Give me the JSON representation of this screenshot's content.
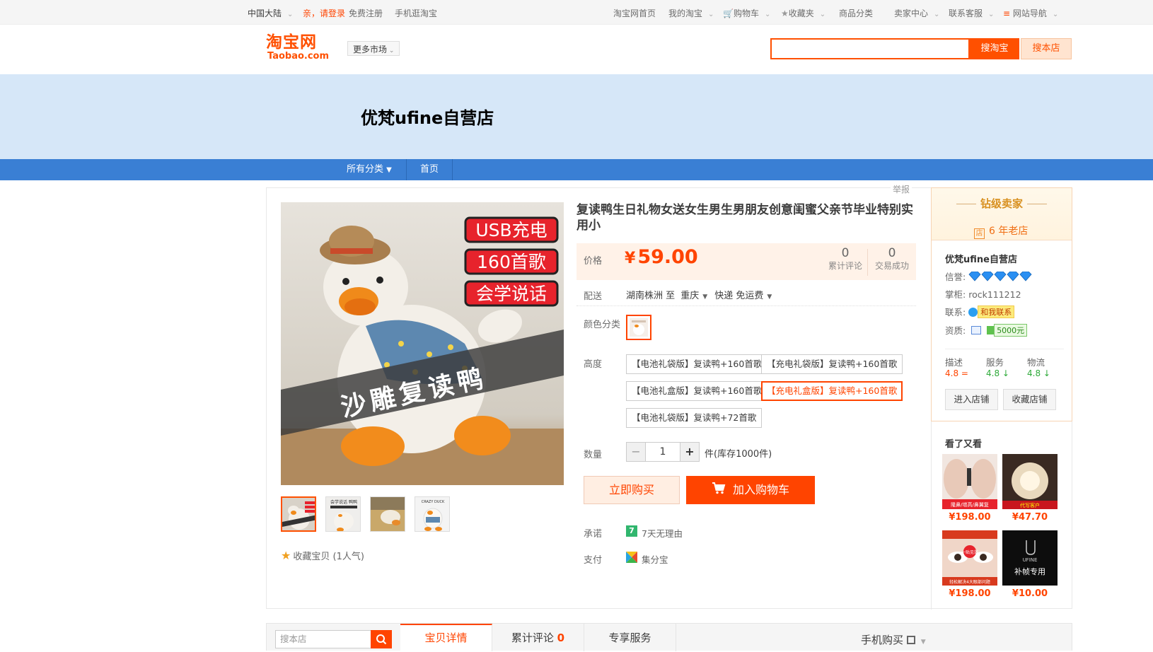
{
  "topbar": {
    "region": "中国大陆",
    "login": "亲，请登录",
    "register": "免费注册",
    "mobile": "手机逛淘宝",
    "home": "淘宝网首页",
    "my_taobao": "我的淘宝",
    "cart": "购物车",
    "favorites": "收藏夹",
    "categories": "商品分类",
    "seller_center": "卖家中心",
    "service": "联系客服",
    "site_nav": "网站导航"
  },
  "header": {
    "logo_cn": "淘宝网",
    "logo_en": "Taobao.com",
    "more_market": "更多市场",
    "search_value": "",
    "search_button": "搜淘宝",
    "search_store_button": "搜本店"
  },
  "banner": {
    "shop_title": "优梵ufine自营店"
  },
  "nav": {
    "all_categories": "所有分类",
    "home": "首页"
  },
  "report": "举报",
  "product": {
    "title": "复读鸭生日礼物女送女生男生男朋友创意闺蜜父亲节毕业特别实用小",
    "main_image_tags": [
      "USB充电",
      "160首歌",
      "会学说话"
    ],
    "main_image_banner": "沙雕复读鸭",
    "thumb_texts": [
      "会学说话 鸭鸭",
      "CRAZY DUCK"
    ],
    "favorite": "收藏宝贝",
    "favorite_count": "(1人气)",
    "price_label": "价格",
    "price_currency": "¥",
    "price": "59.00",
    "reviews_count": "0",
    "reviews_label": "累计评论",
    "deals_count": "0",
    "deals_label": "交易成功",
    "shipping_label": "配送",
    "ship_from": "湖南株洲 至",
    "ship_to": "重庆",
    "ship_method": "快递 免运费",
    "color_label": "颜色分类",
    "height_label": "高度",
    "options": [
      "【电池礼袋版】复读鸭+160首歌",
      "【充电礼袋版】复读鸭+160首歌",
      "【电池礼盒版】复读鸭+160首歌",
      "【充电礼盒版】复读鸭+160首歌",
      "【电池礼袋版】复读鸭+72首歌"
    ],
    "selected_option_index": 3,
    "qty_label": "数量",
    "qty_minus": "−",
    "qty_value": "1",
    "qty_plus": "+",
    "stock": "件(库存1000件)",
    "buy_now": "立即购买",
    "add_to_cart": "加入购物车",
    "promise_label": "承诺",
    "promise_icon": "7",
    "promise": "7天无理由",
    "pay_label": "支付",
    "pay": "集分宝"
  },
  "seller": {
    "rank": "钻级卖家",
    "years_icon": "店",
    "years": "6 年老店",
    "name": "优梵ufine自营店",
    "credit_label": "信誉:",
    "keeper_label": "掌柜:",
    "keeper": "rock111212",
    "contact_label": "联系:",
    "contact_button": "和我联系",
    "qualification_label": "资质:",
    "deposit": "5000元",
    "scores": [
      {
        "name": "描述",
        "value": "4.8",
        "trend": "="
      },
      {
        "name": "服务",
        "value": "4.8",
        "trend": "↓"
      },
      {
        "name": "物流",
        "value": "4.8",
        "trend": "↓"
      }
    ],
    "enter_shop": "进入店铺",
    "favorite_shop": "收藏店铺",
    "see_also": "看了又看",
    "recommendations": [
      {
        "price": "¥198.00"
      },
      {
        "price": "¥47.70"
      },
      {
        "price": "¥198.00"
      },
      {
        "price": "¥10.00"
      }
    ],
    "rec_texts": [
      "隆鼻/增高/鼻翼复",
      "代写客户",
      "一贴见效",
      "轻松解决4大眼部问题",
      "UFINE",
      "补帧专用"
    ]
  },
  "bottom": {
    "search_placeholder": "搜本店",
    "tab_detail": "宝贝详情",
    "tab_reviews": "累计评论",
    "tab_reviews_count": "0",
    "tab_service": "专享服务",
    "mobile_buy": "手机购买"
  },
  "colors": {
    "brand": "#ff5000",
    "price": "#ff4400",
    "nav_blue": "#3a7fd4",
    "banner": "#d6e7f8"
  }
}
